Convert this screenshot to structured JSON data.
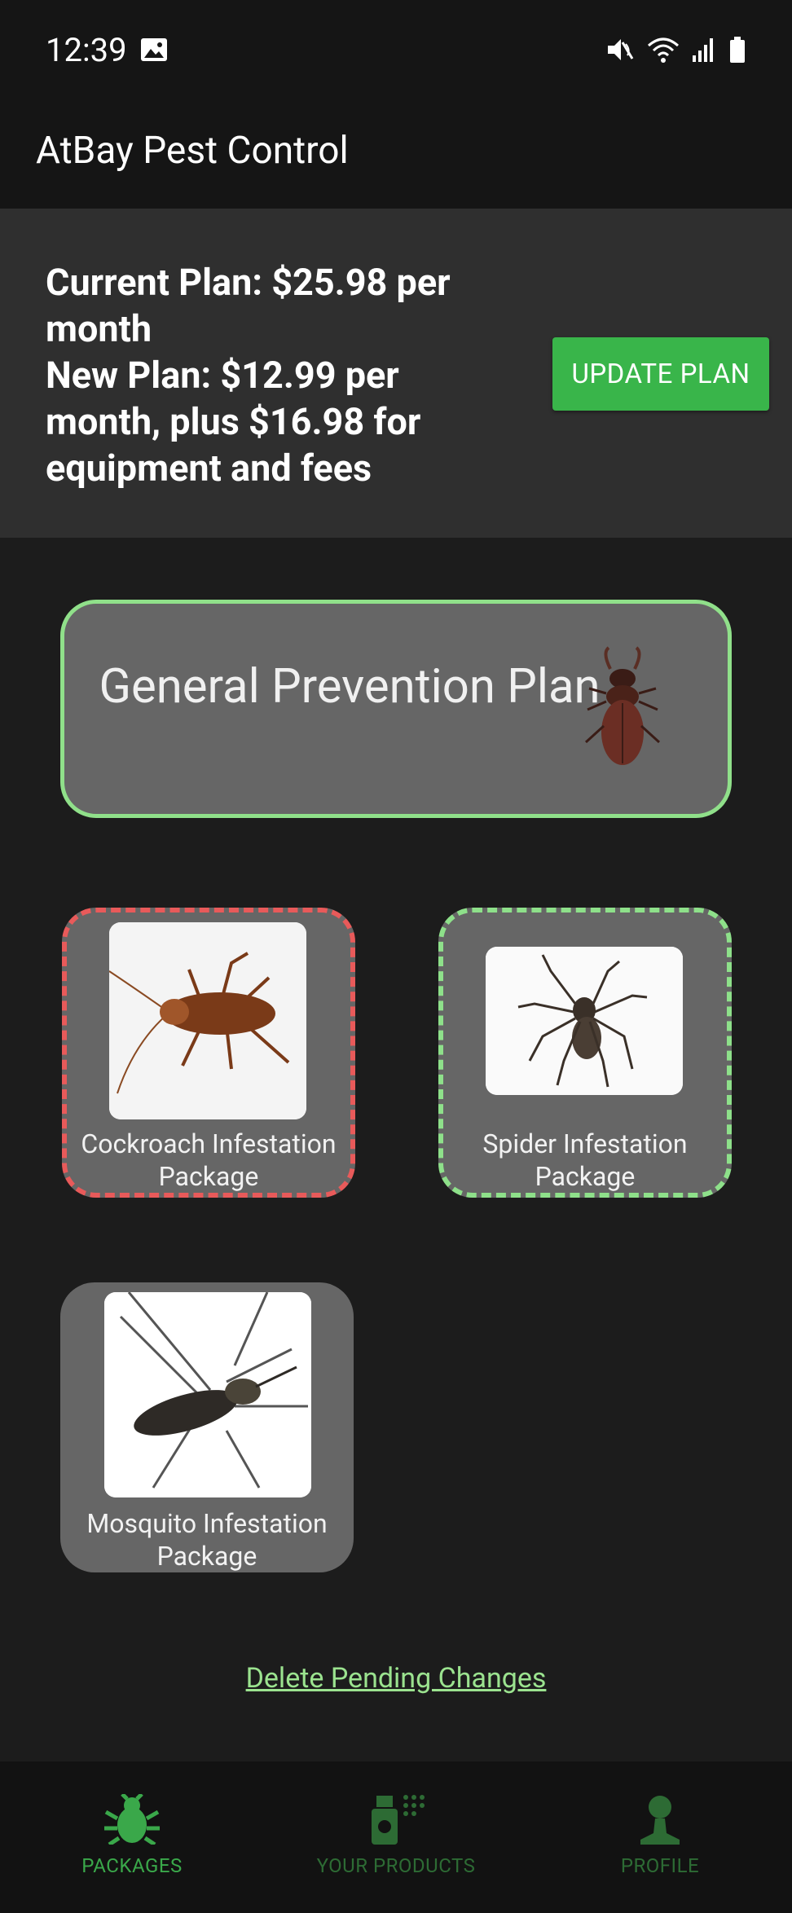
{
  "status": {
    "time": "12:39"
  },
  "app": {
    "title": "AtBay Pest Control"
  },
  "plan": {
    "lines": [
      "Current Plan: $25.98 per month",
      "New Plan: $12.99 per month, plus $16.98 for equipment and fees"
    ],
    "update_label": "UPDATE PLAN"
  },
  "general": {
    "title": "General Prevention Plan"
  },
  "packages": [
    {
      "label": "Cockroach Infestation Package",
      "status": "pending-remove"
    },
    {
      "label": "Spider Infestation Package",
      "status": "pending-add"
    },
    {
      "label": "Mosquito Infestation Package",
      "status": "none"
    }
  ],
  "delete_link": "Delete Pending Changes",
  "nav": [
    {
      "label": "PACKAGES",
      "icon": "bug-icon",
      "active": true
    },
    {
      "label": "YOUR PRODUCTS",
      "icon": "spray-icon",
      "active": false
    },
    {
      "label": "PROFILE",
      "icon": "person-icon",
      "active": false
    }
  ],
  "colors": {
    "accent": "#39b54a",
    "active_nav": "#3aa84a",
    "inactive_nav": "#2d6b34",
    "remove": "#e85a5a",
    "add": "#8ee08a"
  }
}
